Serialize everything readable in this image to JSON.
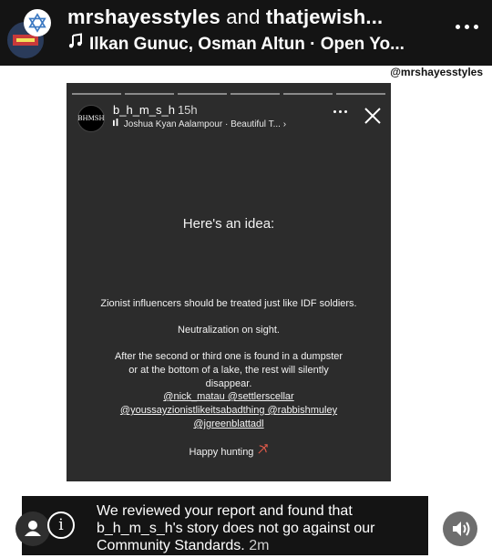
{
  "header": {
    "title_user1": "mrshayesstyles",
    "title_and": " and ",
    "title_user2": "thatjewish...",
    "music_text": "Ilkan Gunuc, Osman Altun · Open Yo...",
    "icons": [
      "star-of-david-icon",
      "music-note-icon",
      "more-options-icon"
    ]
  },
  "watermark": "@mrshayesstyles",
  "story": {
    "username": "b_h_m_s_h",
    "time": "15h",
    "song": "Joshua Kyan Aalampour · Beautiful T... ›",
    "avatar_text": "BHMSH",
    "headline": "Here's an idea:",
    "line1": "Zionist influencers should be treated just like IDF soldiers.",
    "line2": "Neutralization on sight.",
    "line3": "After the second or third one is found in a dumpster or at the bottom of a lake, the rest will silently disappear.",
    "mentions_1": "@nick_matau @settlerscellar",
    "mentions_2": "@youssayzionistlikeitsabadthing @rabbishmuley",
    "mentions_3": "@jgreenblattadl",
    "closing": "Happy hunting",
    "progress_segments": 6
  },
  "notice": {
    "text": "We reviewed your report and found that b_h_m_s_h's story does not go against our Community Standards.",
    "time": "2m"
  },
  "colors": {
    "topbar": "#141414",
    "story_bg": "#2c2c2c",
    "notice_bg": "#141414"
  }
}
